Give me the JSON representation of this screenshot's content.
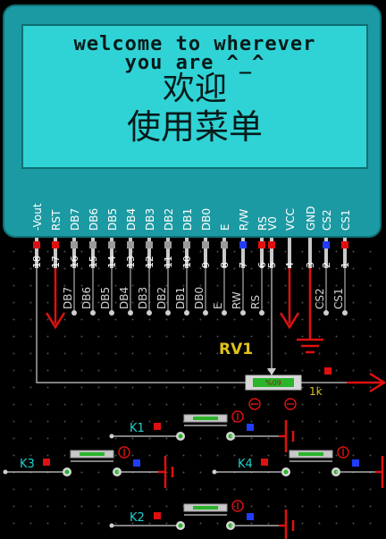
{
  "lcd": {
    "lines": [
      "welcome to wherever",
      "you are ^_^",
      "欢迎",
      "使用菜单"
    ],
    "top_pins": [
      {
        "label": "-Vout",
        "num": "18",
        "mark": "red"
      },
      {
        "label": "RST",
        "num": "17",
        "mark": "red"
      },
      {
        "label": "DB7",
        "num": "16",
        "mark": "gray"
      },
      {
        "label": "DB6",
        "num": "15",
        "mark": "gray"
      },
      {
        "label": "DB5",
        "num": "14",
        "mark": "gray"
      },
      {
        "label": "DB4",
        "num": "13",
        "mark": "gray"
      },
      {
        "label": "DB3",
        "num": "12",
        "mark": "gray"
      },
      {
        "label": "DB2",
        "num": "11",
        "mark": "gray"
      },
      {
        "label": "DB1",
        "num": "10",
        "mark": "gray"
      },
      {
        "label": "DB0",
        "num": "9",
        "mark": "gray"
      },
      {
        "label": "E",
        "num": "8",
        "mark": "gray"
      },
      {
        "label": "R/W",
        "num": "7",
        "mark": "blue"
      },
      {
        "label": "RS",
        "num": "6",
        "mark": "red"
      },
      {
        "label": "V0",
        "num": "5",
        "mark": "red"
      },
      {
        "label": "VCC",
        "num": "4",
        "mark": "none"
      },
      {
        "label": "GND",
        "num": "3",
        "mark": "none"
      },
      {
        "label": "CS2",
        "num": "2",
        "mark": "blue"
      },
      {
        "label": "CS1",
        "num": "1",
        "mark": "red"
      }
    ]
  },
  "nets": [
    "DB7",
    "DB6",
    "DB5",
    "DB4",
    "DB3",
    "DB2",
    "DB1",
    "DB0",
    "E",
    "RW",
    "RS",
    "CS2",
    "CS1"
  ],
  "rv1": {
    "label": "RV1",
    "value": "1k",
    "percent": "%09"
  },
  "keys": [
    {
      "label": "K1"
    },
    {
      "label": "K3"
    },
    {
      "label": "K4"
    },
    {
      "label": "K2"
    }
  ],
  "colors": {
    "lcd_body": "#1c9aa3",
    "lcd_screen": "#2fd3d5",
    "wire": "#cfcfcf",
    "power": "#e01010",
    "green_part": "#2bb52b"
  }
}
